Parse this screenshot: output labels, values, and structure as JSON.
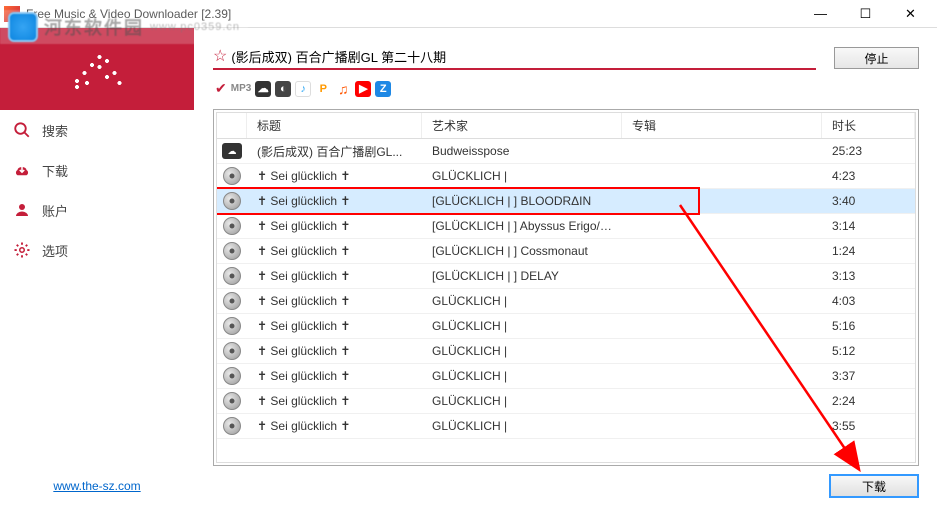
{
  "window": {
    "title": "Free Music & Video Downloader [2.39]"
  },
  "watermark": {
    "site": "河东软件园",
    "url": "www.pc0359.cn"
  },
  "sidebar": {
    "items": [
      {
        "icon": "search",
        "label": "搜索"
      },
      {
        "icon": "download",
        "label": "下载"
      },
      {
        "icon": "account",
        "label": "账户"
      },
      {
        "icon": "settings",
        "label": "选项"
      }
    ],
    "footer_link": "www.the-sz.com"
  },
  "search": {
    "value": "(影后成双) 百合广播剧GL 第二十八期",
    "stop_label": "停止"
  },
  "sources": {
    "checked_label": "MP3"
  },
  "columns": {
    "title": "标题",
    "artist": "艺术家",
    "album": "专辑",
    "duration": "时长"
  },
  "rows": [
    {
      "icon": "cloud",
      "title": "(影后成双) 百合广播剧GL...",
      "artist": "Budweisspose",
      "album": "",
      "duration": "25:23",
      "selected": false
    },
    {
      "icon": "disc",
      "title": "✝ Sei glücklich ✝",
      "artist": "GLÜCKLICH |",
      "album": "",
      "duration": "4:23",
      "selected": false
    },
    {
      "icon": "disc",
      "title": "✝ Sei glücklich ✝",
      "artist": "[GLÜCKLICH |  ] BLOODRΔIN",
      "album": "",
      "duration": "3:40",
      "selected": true,
      "highlight": true
    },
    {
      "icon": "disc",
      "title": "✝ Sei glücklich ✝",
      "artist": "[GLÜCKLICH |  ] Abyssus Erigo/Sky...",
      "album": "",
      "duration": "3:14",
      "selected": false
    },
    {
      "icon": "disc",
      "title": "✝ Sei glücklich ✝",
      "artist": "[GLÜCKLICH |  ] Cossmonaut",
      "album": "",
      "duration": "1:24",
      "selected": false
    },
    {
      "icon": "disc",
      "title": "✝ Sei glücklich ✝",
      "artist": "[GLÜCKLICH |  ] DELAY",
      "album": "",
      "duration": "3:13",
      "selected": false
    },
    {
      "icon": "disc",
      "title": "✝ Sei glücklich ✝",
      "artist": "GLÜCKLICH |",
      "album": "",
      "duration": "4:03",
      "selected": false
    },
    {
      "icon": "disc",
      "title": "✝ Sei glücklich ✝",
      "artist": "GLÜCKLICH |",
      "album": "",
      "duration": "5:16",
      "selected": false
    },
    {
      "icon": "disc",
      "title": "✝ Sei glücklich ✝",
      "artist": "GLÜCKLICH |",
      "album": "",
      "duration": "5:12",
      "selected": false
    },
    {
      "icon": "disc",
      "title": "✝ Sei glücklich ✝",
      "artist": "GLÜCKLICH |",
      "album": "",
      "duration": "3:37",
      "selected": false
    },
    {
      "icon": "disc",
      "title": "✝ Sei glücklich ✝",
      "artist": "GLÜCKLICH |",
      "album": "",
      "duration": "2:24",
      "selected": false
    },
    {
      "icon": "disc",
      "title": "✝ Sei glücklich ✝",
      "artist": "GLÜCKLICH |",
      "album": "",
      "duration": "3:55",
      "selected": false
    }
  ],
  "footer": {
    "download_label": "下载"
  }
}
